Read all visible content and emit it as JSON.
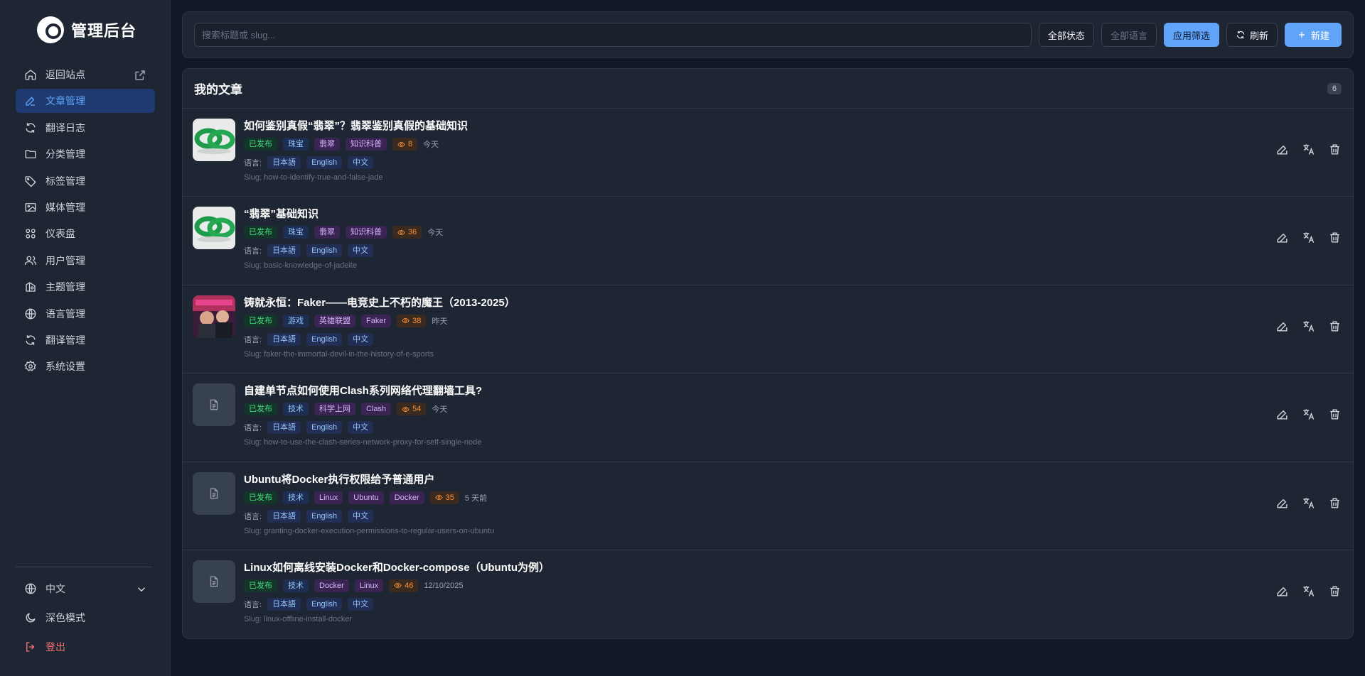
{
  "brand": {
    "title": "管理后台"
  },
  "sidebar": {
    "items": [
      {
        "label": "返回站点",
        "icon": "home-icon"
      },
      {
        "label": "文章管理",
        "icon": "edit-icon",
        "active": true
      },
      {
        "label": "翻译日志",
        "icon": "refresh-icon"
      },
      {
        "label": "分类管理",
        "icon": "folder-icon"
      },
      {
        "label": "标签管理",
        "icon": "tag-icon"
      },
      {
        "label": "媒体管理",
        "icon": "image-icon"
      },
      {
        "label": "仪表盘",
        "icon": "grid-icon"
      },
      {
        "label": "用户管理",
        "icon": "users-icon"
      },
      {
        "label": "主题管理",
        "icon": "palette-icon"
      },
      {
        "label": "语言管理",
        "icon": "globe-icon"
      },
      {
        "label": "翻译管理",
        "icon": "refresh-icon"
      },
      {
        "label": "系统设置",
        "icon": "gear-icon"
      }
    ],
    "bottom": {
      "language": "中文",
      "dark_mode": "深色模式",
      "logout": "登出"
    }
  },
  "toolbar": {
    "search_placeholder": "搜索标题或 slug...",
    "status_filter": "全部状态",
    "lang_filter": "全部语言",
    "apply": "应用筛选",
    "refresh": "刷新",
    "new": "新建"
  },
  "panel": {
    "title": "我的文章",
    "count": "6"
  },
  "articles": [
    {
      "title": "如何鉴别真假“翡翠”？翡翠鉴别真假的基础知识",
      "status": "已发布",
      "category": "珠宝",
      "tags": [
        "翡翠",
        "知识科普"
      ],
      "views": "8",
      "time": "今天",
      "lang_label": "语言:",
      "languages": [
        "日本語",
        "English",
        "中文"
      ],
      "slug": "Slug: how-to-identify-true-and-false-jade",
      "thumb": "jade"
    },
    {
      "title": "“翡翠”基础知识",
      "status": "已发布",
      "category": "珠宝",
      "tags": [
        "翡翠",
        "知识科普"
      ],
      "views": "36",
      "time": "今天",
      "lang_label": "语言:",
      "languages": [
        "日本語",
        "English",
        "中文"
      ],
      "slug": "Slug: basic-knowledge-of-jadeite",
      "thumb": "jade"
    },
    {
      "title": "铸就永恒：Faker——电竞史上不朽的魔王（2013-2025）",
      "status": "已发布",
      "category": "游戏",
      "tags": [
        "英雄联盟",
        "Faker"
      ],
      "views": "38",
      "time": "昨天",
      "lang_label": "语言:",
      "languages": [
        "日本語",
        "English",
        "中文"
      ],
      "slug": "Slug: faker-the-immortal-devil-in-the-history-of-e-sports",
      "thumb": "photo"
    },
    {
      "title": "自建单节点如何使用Clash系列网络代理翻墙工具?",
      "status": "已发布",
      "category": "技术",
      "tags": [
        "科学上网",
        "Clash"
      ],
      "views": "54",
      "time": "今天",
      "lang_label": "语言:",
      "languages": [
        "日本語",
        "English",
        "中文"
      ],
      "slug": "Slug: how-to-use-the-clash-series-network-proxy-for-self-single-node",
      "thumb": "placeholder"
    },
    {
      "title": "Ubuntu将Docker执行权限给予普通用户",
      "status": "已发布",
      "category": "技术",
      "tags": [
        "Linux",
        "Ubuntu",
        "Docker"
      ],
      "views": "35",
      "time": "5 天前",
      "lang_label": "语言:",
      "languages": [
        "日本語",
        "English",
        "中文"
      ],
      "slug": "Slug: granting-docker-execution-permissions-to-regular-users-on-ubuntu",
      "thumb": "placeholder"
    },
    {
      "title": "Linux如何离线安装Docker和Docker-compose（Ubuntu为例）",
      "status": "已发布",
      "category": "技术",
      "tags": [
        "Docker",
        "Linux"
      ],
      "views": "46",
      "time": "12/10/2025",
      "lang_label": "语言:",
      "languages": [
        "日本語",
        "English",
        "中文"
      ],
      "slug": "Slug: linux-offline-install-docker",
      "thumb": "placeholder"
    }
  ]
}
